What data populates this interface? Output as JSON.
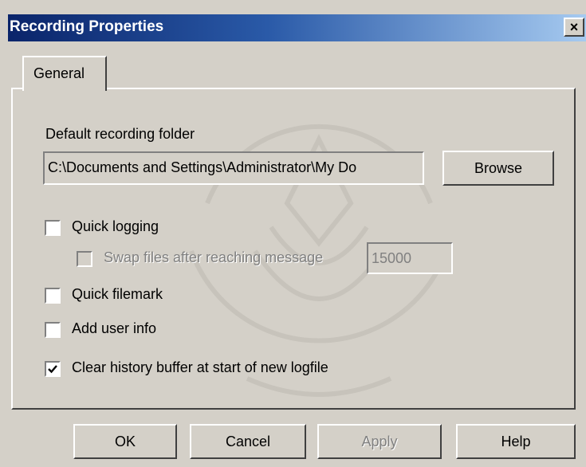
{
  "window": {
    "title": "Recording Properties",
    "close_icon": "close-icon",
    "close_glyph": "×"
  },
  "tabs": [
    {
      "label": "General",
      "selected": true
    }
  ],
  "general": {
    "folder_label": "Default recording folder",
    "folder_value": "C:\\Documents and Settings\\Administrator\\My Do",
    "browse_label": "Browse",
    "quick_logging": {
      "label": "Quick logging",
      "checked": false
    },
    "swap_files": {
      "label": "Swap files after reaching message",
      "checked": false,
      "enabled": false,
      "value": "15000"
    },
    "quick_filemark": {
      "label": "Quick filemark",
      "checked": false
    },
    "add_user_info": {
      "label": "Add user info",
      "checked": false
    },
    "clear_history": {
      "label": "Clear history buffer at start of new logfile",
      "checked": true
    }
  },
  "buttons": {
    "ok": "OK",
    "cancel": "Cancel",
    "apply": "Apply",
    "help": "Help"
  },
  "colors": {
    "face": "#d4d0c8",
    "title_start": "#0a246a",
    "title_end": "#a6caf0"
  }
}
